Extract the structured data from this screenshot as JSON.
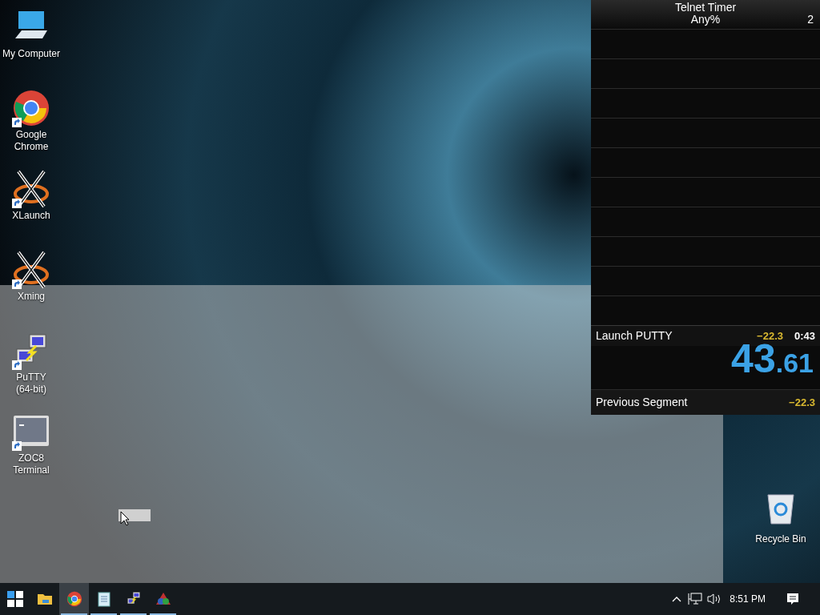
{
  "desktop_icons": [
    {
      "kind": "computer",
      "label": "My Computer",
      "shortcut": false
    },
    {
      "kind": "chrome",
      "label": "Google Chrome",
      "shortcut": true
    },
    {
      "kind": "x",
      "label": "XLaunch",
      "shortcut": true
    },
    {
      "kind": "x",
      "label": "Xming",
      "shortcut": true
    },
    {
      "kind": "putty",
      "label": "PuTTY (64-bit)",
      "shortcut": true
    },
    {
      "kind": "terminal",
      "label": "ZOC8 Terminal",
      "shortcut": true
    }
  ],
  "recycle_bin": {
    "label": "Recycle Bin"
  },
  "timer": {
    "title": "Telnet Timer",
    "category": "Any%",
    "attempts": "2",
    "current_split": {
      "name": "Launch PUTTY",
      "delta": "−22.3",
      "time": "0:43"
    },
    "main_time": {
      "whole": "43",
      "fraction": ".61"
    },
    "previous_segment": {
      "label": "Previous Segment",
      "value": "−22.3"
    }
  },
  "taskbar": {
    "apps": [
      {
        "kind": "start",
        "running": false,
        "selected": false
      },
      {
        "kind": "folder",
        "running": false,
        "selected": false
      },
      {
        "kind": "chrome",
        "running": true,
        "selected": true
      },
      {
        "kind": "notepad",
        "running": true,
        "selected": false
      },
      {
        "kind": "putty",
        "running": true,
        "selected": false
      },
      {
        "kind": "triangle",
        "running": true,
        "selected": false
      }
    ],
    "clock": "8:51 PM"
  }
}
